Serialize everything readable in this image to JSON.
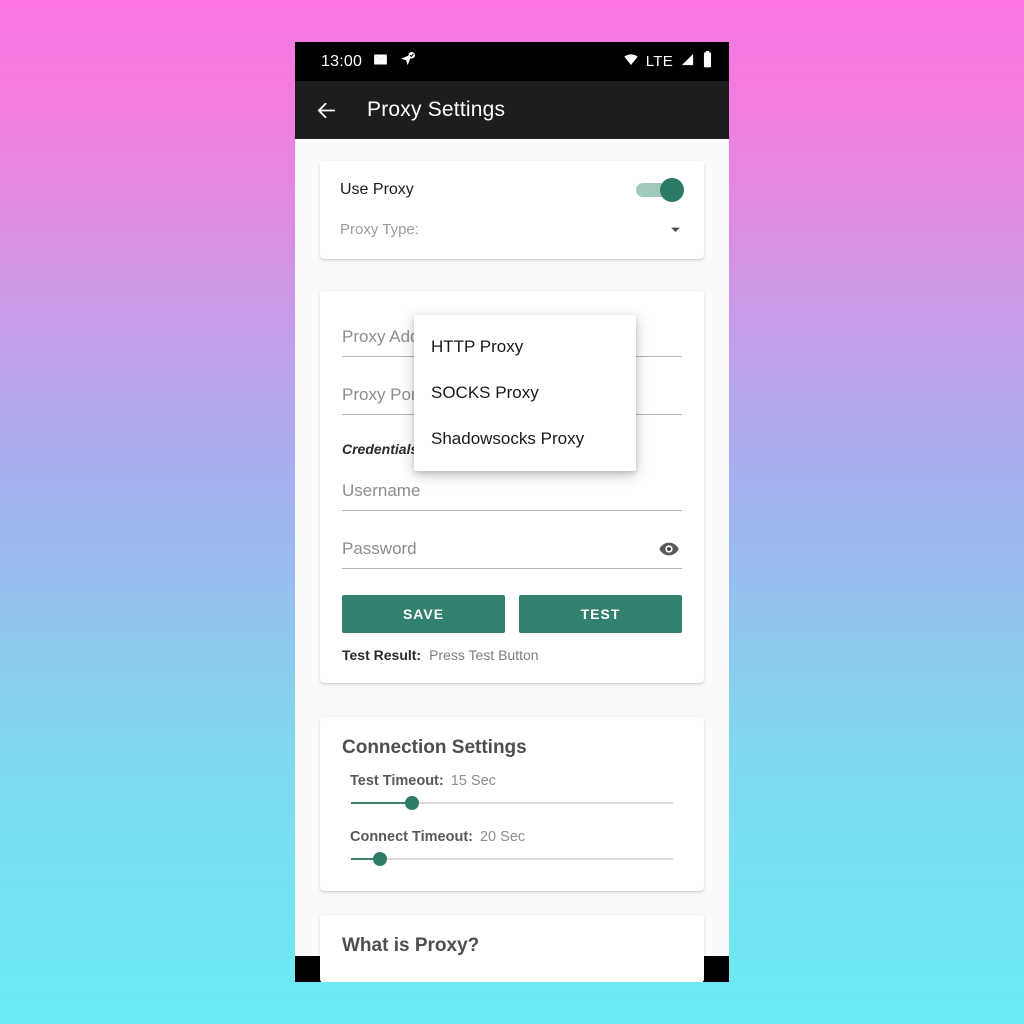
{
  "status_bar": {
    "time": "13:00",
    "network_label": "LTE",
    "icons": [
      "mail-icon",
      "location-verified-icon",
      "wifi-icon",
      "signal-icon",
      "battery-icon"
    ]
  },
  "app_bar": {
    "back_icon": "arrow-back-icon",
    "title": "Proxy Settings"
  },
  "proxy_toggle_card": {
    "use_proxy_label": "Use Proxy",
    "use_proxy_enabled": true,
    "proxy_type_label": "Proxy Type:",
    "caret_icon": "chevron-down-icon"
  },
  "proxy_type_dropdown": {
    "open": true,
    "options": [
      "HTTP Proxy",
      "SOCKS Proxy",
      "Shadowsocks Proxy"
    ]
  },
  "proxy_form_card": {
    "address_placeholder": "Proxy Address",
    "address_value": "",
    "port_placeholder": "Proxy Port",
    "port_value": "",
    "credentials_heading": "Credentials (Optional)",
    "username_placeholder": "Username",
    "username_value": "",
    "password_placeholder": "Password",
    "password_value": "",
    "password_eye_icon": "eye-icon",
    "save_label": "SAVE",
    "test_label": "TEST",
    "test_result_label": "Test Result:",
    "test_result_value": "Press Test Button"
  },
  "connection_card": {
    "title": "Connection Settings",
    "sliders": [
      {
        "name": "Test Timeout:",
        "value": "15 Sec",
        "percent": 19
      },
      {
        "name": "Connect Timeout:",
        "value": "20 Sec",
        "percent": 9
      }
    ]
  },
  "info_card": {
    "title": "What is Proxy?"
  },
  "colors": {
    "accent": "#32806e",
    "switch_thumb": "#2c7a68",
    "switch_track": "#9fc9bd",
    "app_bar": "#1d1d1d",
    "status_bar": "#000000",
    "page_bg": "#fafafa",
    "backdrop_top": "#fb74e2",
    "backdrop_bottom": "#6ceaf2"
  }
}
